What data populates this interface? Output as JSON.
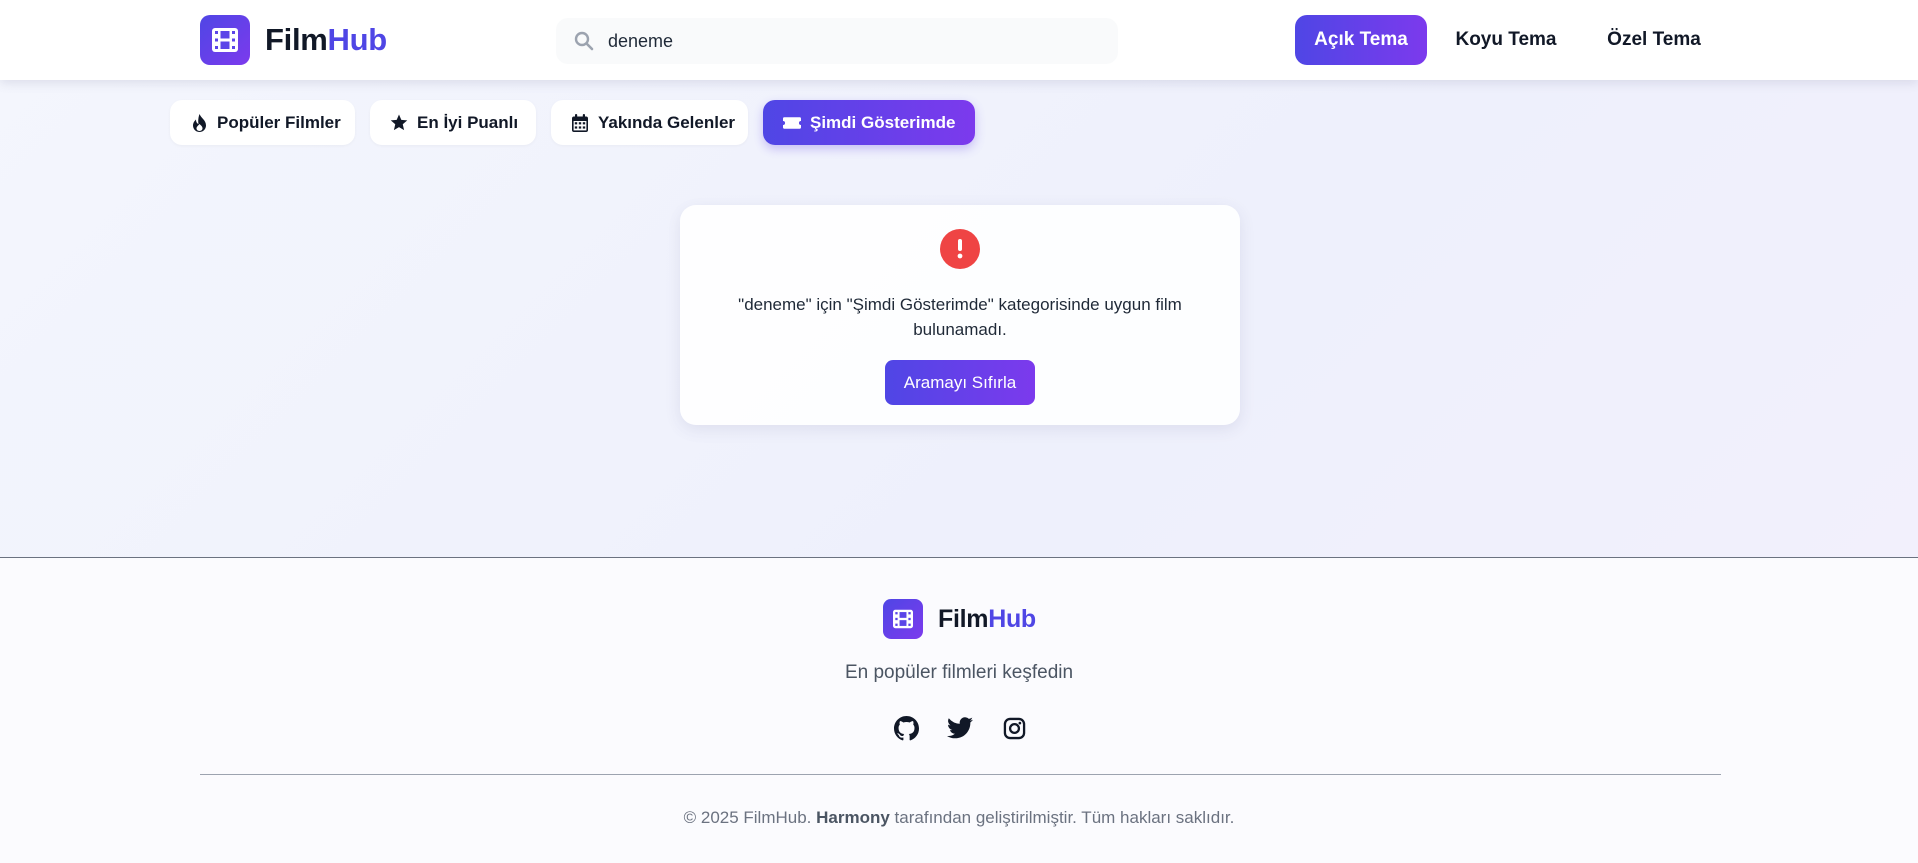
{
  "header": {
    "logo": {
      "film": "Film",
      "hub": "Hub",
      "icon": "film-icon"
    },
    "search": {
      "value": "deneme",
      "placeholder": "",
      "icon": "search-icon"
    },
    "themes": {
      "light": "Açık Tema",
      "dark": "Koyu Tema",
      "custom": "Özel Tema"
    }
  },
  "tabs": [
    {
      "label": "Popüler Filmler",
      "icon": "fire-icon"
    },
    {
      "label": "En İyi Puanlı",
      "icon": "star-icon"
    },
    {
      "label": "Yakında Gelenler",
      "icon": "calendar-icon"
    },
    {
      "label": "Şimdi Gösterimde",
      "icon": "ticket-icon",
      "active": true
    }
  ],
  "empty_state": {
    "icon": "alert-icon",
    "message": "\"deneme\" için \"Şimdi Gösterimde\" kategorisinde uygun film bulunamadı.",
    "button": "Aramayı Sıfırla"
  },
  "footer": {
    "logo": {
      "film": "Film",
      "hub": "Hub"
    },
    "tagline": "En popüler filmleri keşfedin",
    "social": [
      "github-icon",
      "twitter-icon",
      "instagram-icon"
    ],
    "copyright": {
      "prefix": "© 2025 FilmHub. ",
      "author": "Harmony",
      "suffix": " tarafından geliştirilmiştir. Tüm hakları saklıdır."
    }
  },
  "colors": {
    "accent": "#4f46e5",
    "accent_end": "#7c3aed",
    "danger": "#ef4444"
  }
}
